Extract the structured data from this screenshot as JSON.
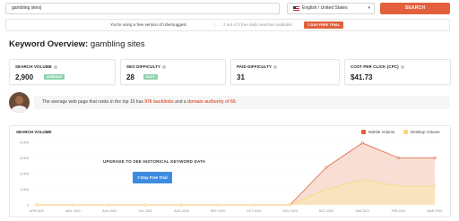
{
  "search": {
    "value": "gambling sites|",
    "language": "English / United States",
    "button": "SEARCH"
  },
  "notice": {
    "message": "You're using a free version of Ubersuggest",
    "count": "2 out of 3 free daily searches available",
    "trial_label": "7-DAY FREE TRIAL"
  },
  "overview": {
    "title_prefix": "Keyword Overview:",
    "keyword": "gambling sites"
  },
  "metrics": [
    {
      "label": "SEARCH VOLUME",
      "value": "2,900",
      "badge": "AVERAGE",
      "badge_color": "#8fd3b0"
    },
    {
      "label": "SEO DIFFICULTY",
      "value": "28",
      "badge": "EASY",
      "badge_color": "#8fd3b0"
    },
    {
      "label": "PAID DIFFICULTY",
      "value": "31"
    },
    {
      "label": "COST PER CLICK (CPC)",
      "value": "$41.73"
    }
  ],
  "insight": {
    "prefix": "The average web page that ranks in the top 10 has ",
    "backlinks": "976 backlinks",
    "middle": " and a ",
    "authority": "domain authority of 60",
    "suffix": "."
  },
  "chart": {
    "title": "SEARCH VOLUME",
    "upgrade_text": "UPGRADE TO SEE HISTORICAL KEYWORD DATA",
    "trial_button": "7-Day Free Trial",
    "colors": {
      "mobile": "#e2603c",
      "desktop": "#f7d77a"
    }
  },
  "chart_data": {
    "type": "area",
    "categories": [
      "APR 2020",
      "MAY 2020",
      "JUN 2020",
      "JUL 2020",
      "AUG 2020",
      "SEP 2020",
      "OCT 2020",
      "NOV 2020",
      "DEC 2020",
      "JAN 2021",
      "FEB 2021",
      "MAR 2021"
    ],
    "series": [
      {
        "name": "Mobile Volume",
        "values": [
          0,
          0,
          0,
          0,
          0,
          0,
          0,
          0,
          2400,
          3950,
          3000,
          3000
        ]
      },
      {
        "name": "Desktop Volume",
        "values": [
          0,
          0,
          0,
          0,
          0,
          0,
          0,
          0,
          1000,
          1600,
          1200,
          1200
        ]
      }
    ],
    "y_ticks": [
      "0",
      "1,000",
      "2,000",
      "3,000",
      "4,000"
    ],
    "ylim": [
      0,
      4000
    ]
  }
}
